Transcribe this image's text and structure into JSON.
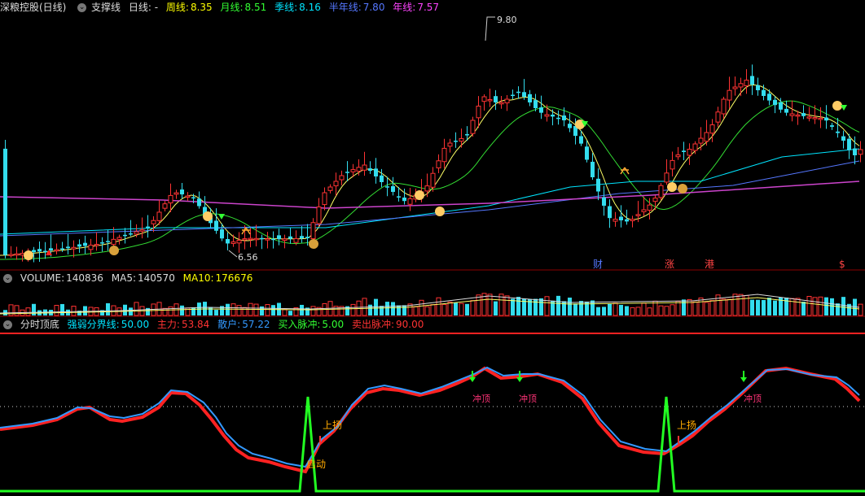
{
  "main_header": {
    "stock_name": "深粮控股(日线)",
    "indicator": "支撑线",
    "period": "日线: -",
    "lines": [
      {
        "label": "周线:",
        "value": "8.35",
        "color": "#ffff00"
      },
      {
        "label": "月线:",
        "value": "8.51",
        "color": "#33ff33"
      },
      {
        "label": "季线:",
        "value": "8.16",
        "color": "#00e5ff"
      },
      {
        "label": "半年线:",
        "value": "7.80",
        "color": "#5577ff"
      },
      {
        "label": "年线:",
        "value": "7.57",
        "color": "#ff44ff"
      }
    ]
  },
  "price_chart": {
    "high_label": "9.80",
    "low_label": "6.56",
    "event_markers": [
      {
        "text": "财",
        "color": "#5577ff"
      },
      {
        "text": "涨",
        "color": "#ff4444"
      },
      {
        "text": "港",
        "color": "#ff4444"
      },
      {
        "text": "$",
        "color": "#ff4444"
      }
    ]
  },
  "volume_header": {
    "items": [
      {
        "label": "VOLUME:",
        "value": "140836",
        "color": "#dddddd"
      },
      {
        "label": "MA5:",
        "value": "140570",
        "color": "#dddddd"
      },
      {
        "label": "MA10:",
        "value": "176676",
        "color": "#ffff00"
      }
    ]
  },
  "osc_header": {
    "title": "分时顶底",
    "items": [
      {
        "label": "强弱分界线:",
        "value": "50.00",
        "color": "#00e5ff"
      },
      {
        "label": "主力:",
        "value": "53.84",
        "color": "#ff3333"
      },
      {
        "label": "散户:",
        "value": "57.22",
        "color": "#3399ff"
      },
      {
        "label": "买入脉冲:",
        "value": "5.00",
        "color": "#33ff33"
      },
      {
        "label": "卖出脉冲:",
        "value": "90.00",
        "color": "#ff3333"
      }
    ]
  },
  "osc_labels": {
    "chongding": "冲顶",
    "shangyang": "上扬",
    "qidong": "启动"
  }
}
